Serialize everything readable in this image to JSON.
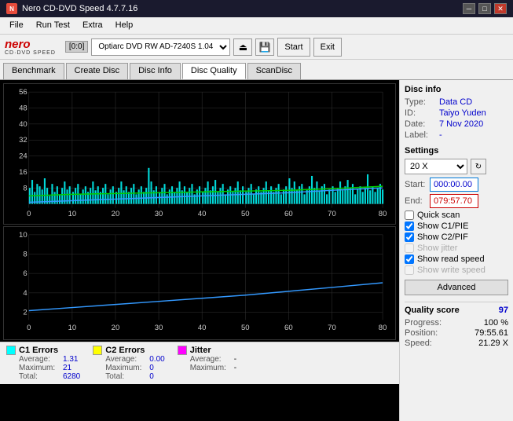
{
  "titleBar": {
    "title": "Nero CD-DVD Speed 4.7.7.16",
    "controls": [
      "minimize",
      "maximize",
      "close"
    ]
  },
  "menuBar": {
    "items": [
      "File",
      "Run Test",
      "Extra",
      "Help"
    ]
  },
  "toolbar": {
    "drive_badge": "[0:0]",
    "drive_label": "Optiarc DVD RW AD-7240S 1.04",
    "start_label": "Start",
    "exit_label": "Exit"
  },
  "tabs": {
    "items": [
      "Benchmark",
      "Create Disc",
      "Disc Info",
      "Disc Quality",
      "ScanDisc"
    ],
    "active": "Disc Quality"
  },
  "discInfo": {
    "section_label": "Disc info",
    "type_label": "Type:",
    "type_value": "Data CD",
    "id_label": "ID:",
    "id_value": "Taiyo Yuden",
    "date_label": "Date:",
    "date_value": "7 Nov 2020",
    "label_label": "Label:",
    "label_value": "-"
  },
  "settings": {
    "section_label": "Settings",
    "speed_value": "20 X",
    "start_label": "Start:",
    "start_value": "000:00.00",
    "end_label": "End:",
    "end_value": "079:57.70",
    "quick_scan_label": "Quick scan",
    "quick_scan_checked": false,
    "show_c1pie_label": "Show C1/PIE",
    "show_c1pie_checked": true,
    "show_c2pif_label": "Show C2/PIF",
    "show_c2pif_checked": true,
    "show_jitter_label": "Show jitter",
    "show_jitter_checked": false,
    "show_jitter_disabled": true,
    "show_read_speed_label": "Show read speed",
    "show_read_speed_checked": true,
    "show_write_speed_label": "Show write speed",
    "show_write_speed_checked": false,
    "show_write_speed_disabled": true,
    "advanced_label": "Advanced"
  },
  "quality": {
    "score_label": "Quality score",
    "score_value": "97",
    "progress_label": "Progress:",
    "progress_value": "100 %",
    "position_label": "Position:",
    "position_value": "79:55.61",
    "speed_label": "Speed:",
    "speed_value": "21.29 X"
  },
  "legend": {
    "c1": {
      "title": "C1 Errors",
      "color": "#00ffff",
      "average_label": "Average:",
      "average_value": "1.31",
      "maximum_label": "Maximum:",
      "maximum_value": "21",
      "total_label": "Total:",
      "total_value": "6280"
    },
    "c2": {
      "title": "C2 Errors",
      "color": "#ffff00",
      "average_label": "Average:",
      "average_value": "0.00",
      "maximum_label": "Maximum:",
      "maximum_value": "0",
      "total_label": "Total:",
      "total_value": "0"
    },
    "jitter": {
      "title": "Jitter",
      "color": "#ff00ff",
      "average_label": "Average:",
      "average_value": "-",
      "maximum_label": "Maximum:",
      "maximum_value": "-"
    }
  },
  "chart": {
    "top_y_labels": [
      "56",
      "48",
      "40",
      "32",
      "24",
      "16",
      "8"
    ],
    "bottom_y_labels": [
      "10",
      "8",
      "6",
      "4",
      "2"
    ],
    "x_labels": [
      "0",
      "10",
      "20",
      "30",
      "40",
      "50",
      "60",
      "70",
      "80"
    ]
  }
}
